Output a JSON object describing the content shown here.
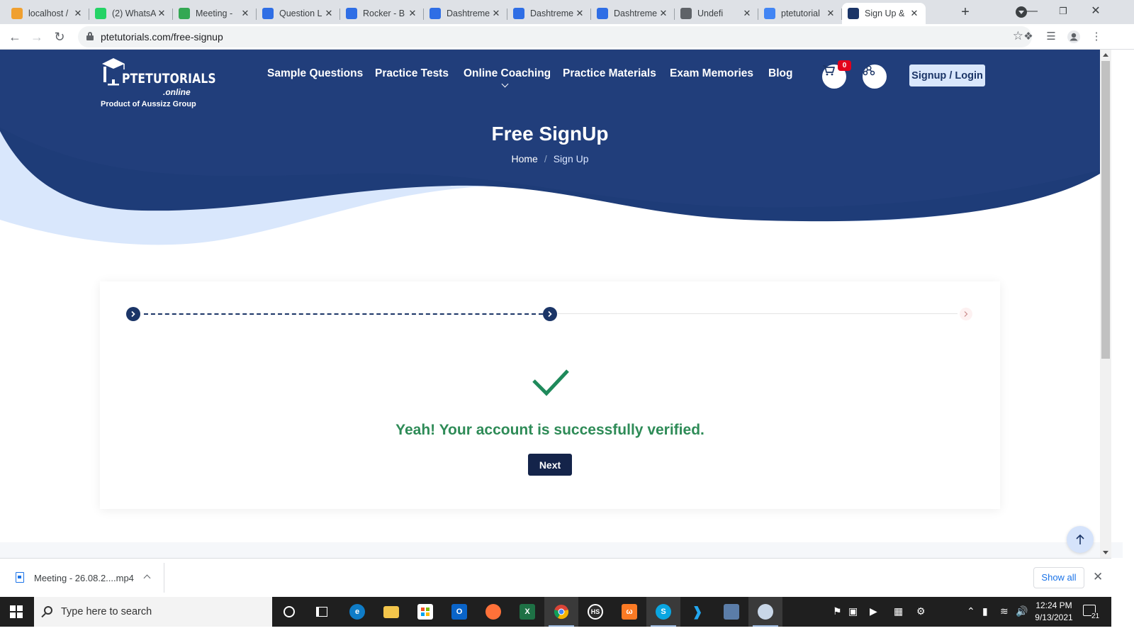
{
  "browser": {
    "tabs": [
      {
        "title": "localhost /",
        "favicon_color": "#f0a030",
        "active": false
      },
      {
        "title": "(2) WhatsA",
        "favicon_color": "#25d366",
        "active": false
      },
      {
        "title": "Meeting -",
        "favicon_color": "#34a853",
        "active": false
      },
      {
        "title": "Question L",
        "favicon_color": "#2f6ee5",
        "active": false
      },
      {
        "title": "Rocker - B",
        "favicon_color": "#2f6ee5",
        "active": false
      },
      {
        "title": "Dashtreme",
        "favicon_color": "#2f6ee5",
        "active": false
      },
      {
        "title": "Dashtreme",
        "favicon_color": "#2f6ee5",
        "active": false
      },
      {
        "title": "Dashtreme",
        "favicon_color": "#2f6ee5",
        "active": false
      },
      {
        "title": "Undefi",
        "favicon_color": "#5f6368",
        "active": false
      },
      {
        "title": "ptetutorial",
        "favicon_color": "#4285f4",
        "active": false
      },
      {
        "title": "Sign Up &",
        "favicon_color": "#1b3567",
        "active": true
      }
    ],
    "url": "ptetutorials.com/free-signup"
  },
  "site": {
    "logo": {
      "brand": "PTETUTORIALS",
      "suffix": ".online",
      "product_of": "Product of ",
      "group": "Aussizz Group"
    },
    "nav": [
      "Sample Questions",
      "Practice Tests",
      "Online Coaching",
      "Practice Materials",
      "Exam Memories",
      "Blog"
    ],
    "cart_count": "0",
    "signup_login": "Signup / Login",
    "page_title": "Free SignUp",
    "breadcrumb": {
      "home": "Home",
      "separator": "/",
      "current": "Sign Up"
    },
    "steps": {
      "total": 3,
      "completed": 2
    },
    "success_message": "Yeah! Your account is successfully verified.",
    "next_button": "Next",
    "colors": {
      "primary": "#1b3567",
      "success": "#2e8b57",
      "accent_light": "#d9e7fc",
      "badge": "#e3001b"
    }
  },
  "download_shelf": {
    "file_name": "Meeting - 26.08.2....mp4",
    "show_all": "Show all"
  },
  "taskbar": {
    "search_placeholder": "Type here to search",
    "time": "12:24 PM",
    "date": "9/13/2021",
    "notification_count": "21"
  }
}
